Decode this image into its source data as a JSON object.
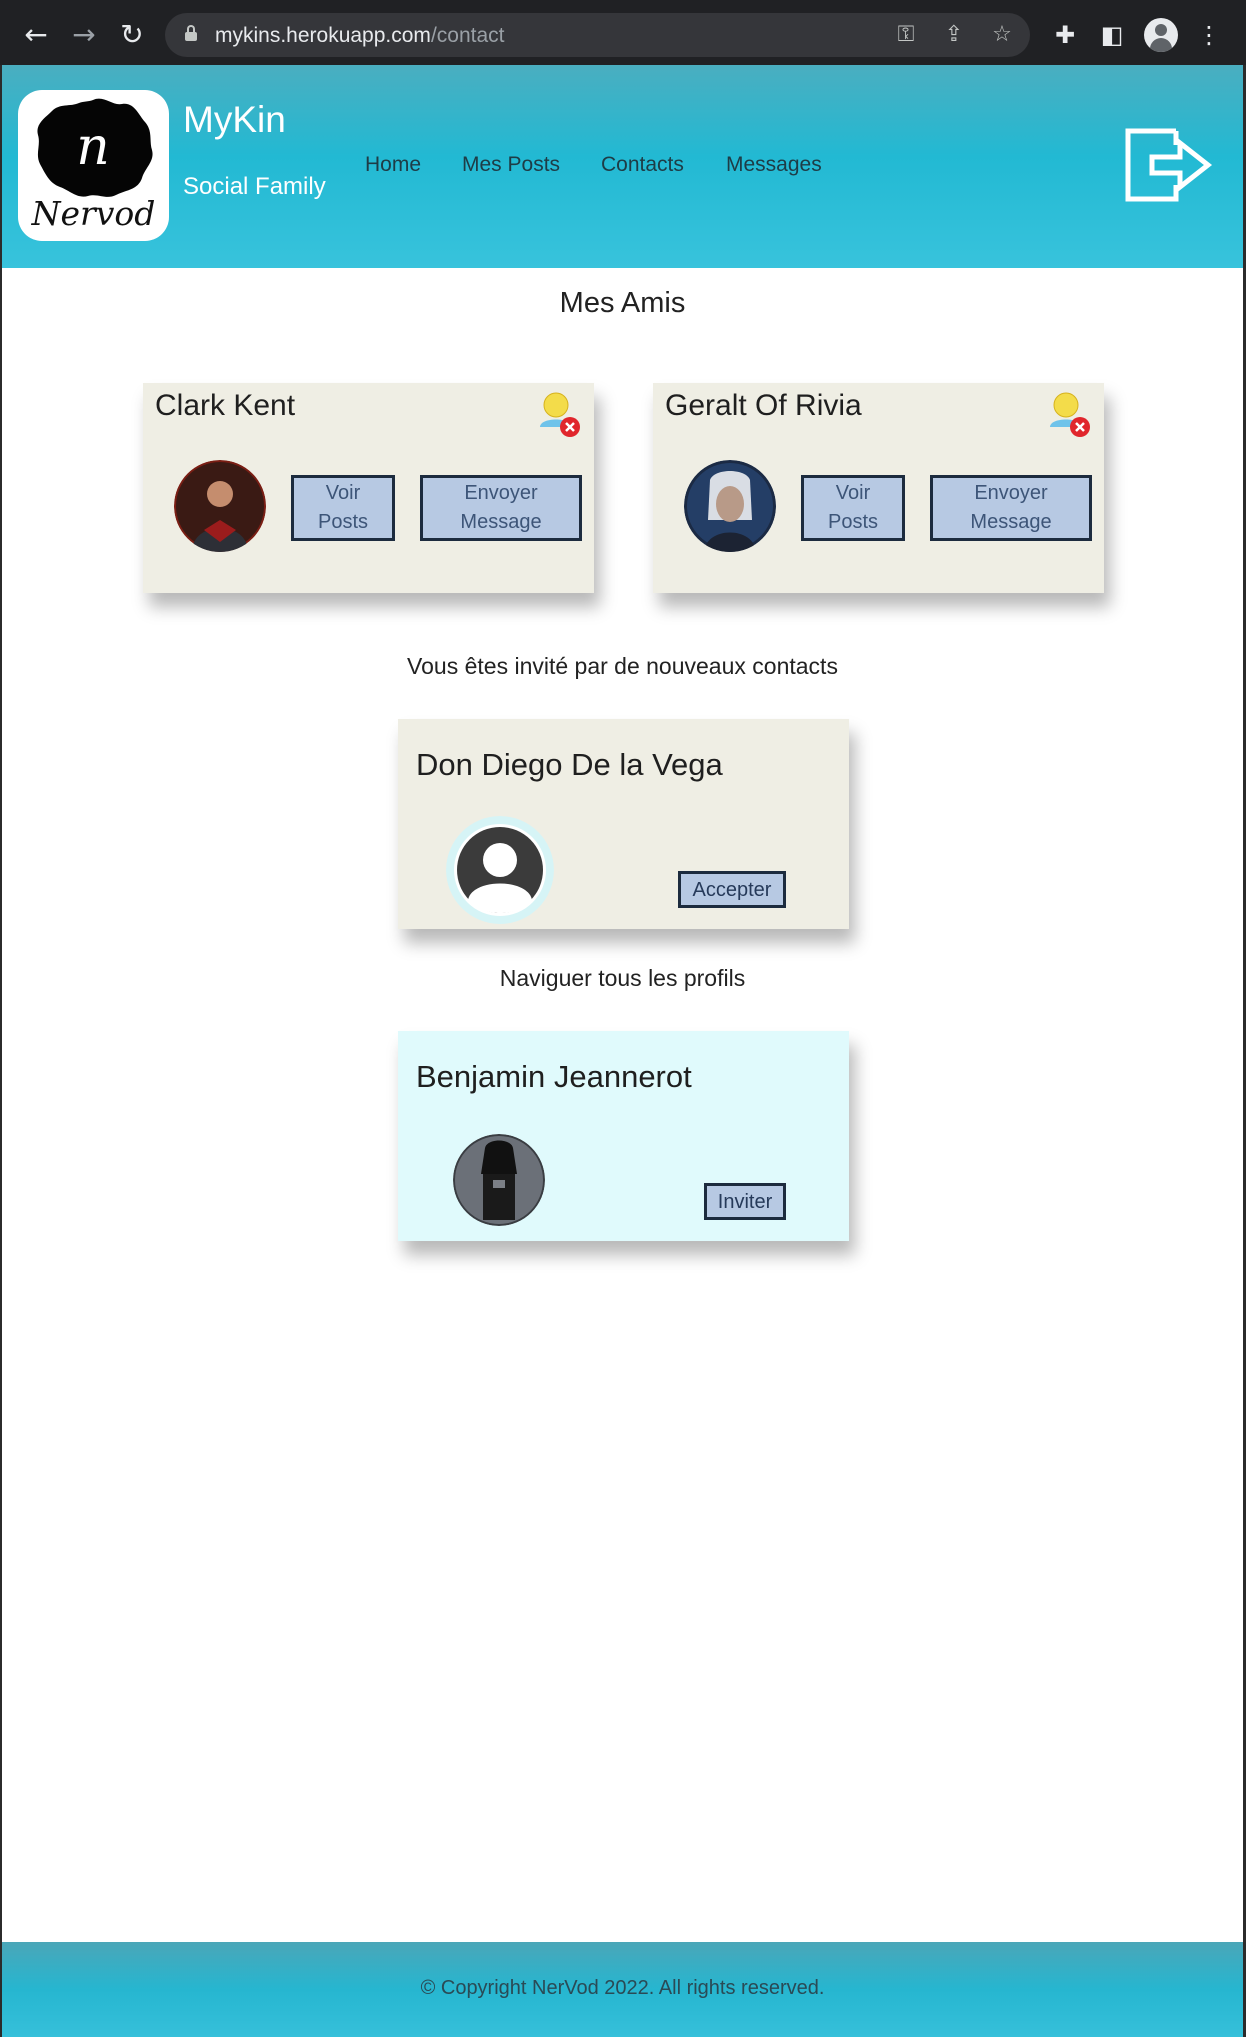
{
  "browser": {
    "url_host": "mykins.herokuapp.com",
    "url_path": "/contact",
    "back_icon": "arrow-left-icon",
    "forward_icon": "arrow-right-icon",
    "reload_icon": "reload-icon"
  },
  "header": {
    "logo_letter": "n",
    "logo_script": "Nervod",
    "title": "MyKin",
    "subtitle": "Social Family",
    "nav": [
      "Home",
      "Mes Posts",
      "Contacts",
      "Messages"
    ],
    "logout_icon": "logout-icon"
  },
  "friends": {
    "title": "Mes Amis",
    "cards": [
      {
        "name": "Clark Kent",
        "view_posts": [
          "Voir",
          "Posts"
        ],
        "send_message": [
          "Envoyer",
          "Message"
        ]
      },
      {
        "name": "Geralt Of Rivia",
        "view_posts": [
          "Voir",
          "Posts"
        ],
        "send_message": [
          "Envoyer",
          "Message"
        ]
      }
    ]
  },
  "invitations": {
    "title": "Vous êtes invité par de nouveaux contacts",
    "cards": [
      {
        "name": "Don Diego De la Vega",
        "action": "Accepter"
      }
    ]
  },
  "browse": {
    "title": "Naviguer tous les profils",
    "cards": [
      {
        "name": "Benjamin Jeannerot",
        "action": "Inviter"
      }
    ]
  },
  "footer": {
    "text": "© Copyright NerVod 2022. All rights reserved."
  },
  "colors": {
    "header_accent": "#22b9d3",
    "card_bg": "#efeee4",
    "card_alt_bg": "#e0fafc",
    "button_bg": "#b7c9e3"
  }
}
